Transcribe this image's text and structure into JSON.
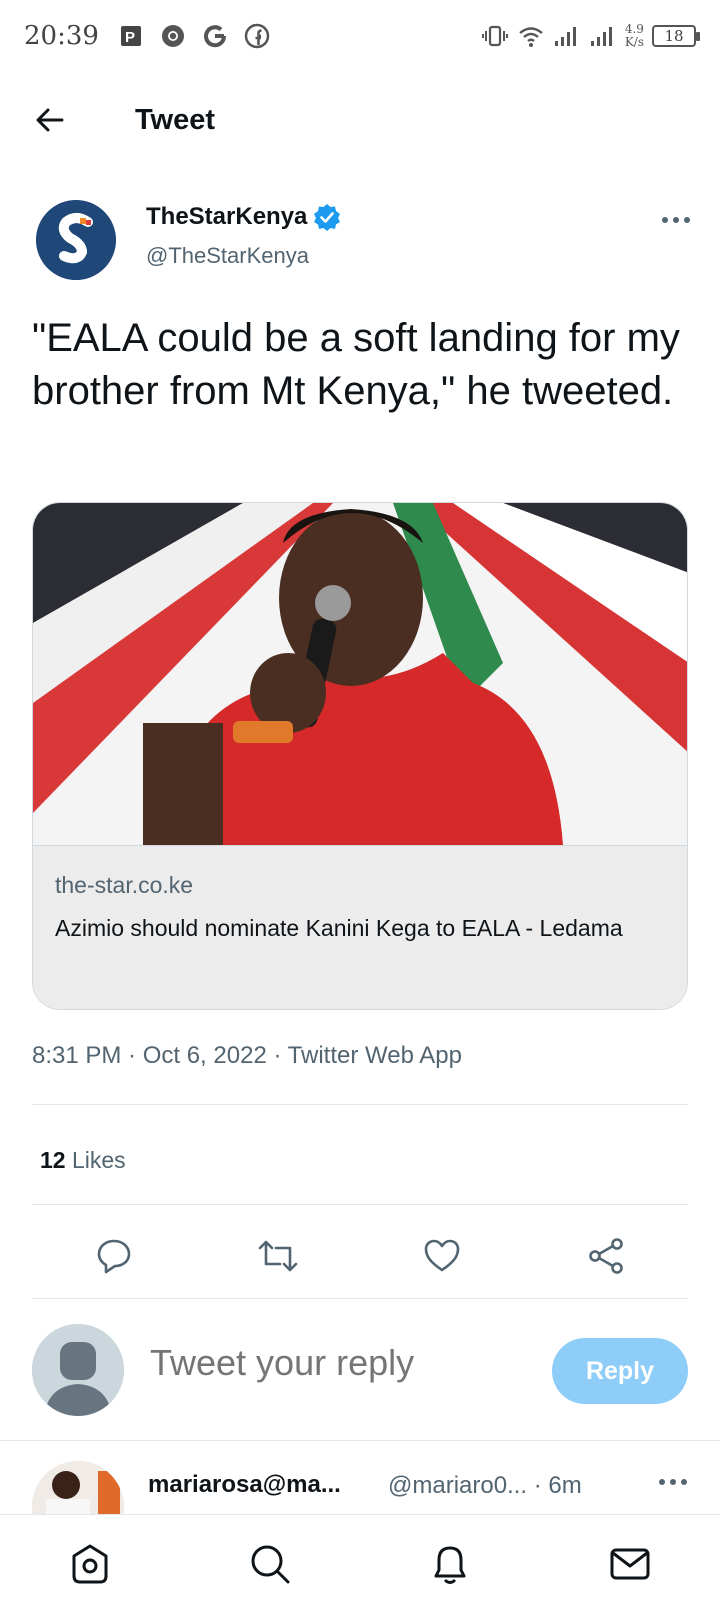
{
  "status_bar": {
    "time": "20:39",
    "net_speed_value": "4.9",
    "net_speed_unit": "K/s",
    "battery": "18",
    "left_icons": [
      "parking-icon",
      "chrome-icon",
      "google-icon",
      "facebook-icon"
    ],
    "right_icons": [
      "vibrate-icon",
      "wifi-icon",
      "signal-icon",
      "signal-icon"
    ]
  },
  "header": {
    "title": "Tweet",
    "back_icon": "arrow-left-icon"
  },
  "tweet": {
    "author_name": "TheStarKenya",
    "verified": true,
    "author_handle": "@TheStarKenya",
    "text": "\"EALA could be a soft landing for my brother from Mt Kenya,\" he tweeted.",
    "card": {
      "domain": "the-star.co.ke",
      "title": "Azimio should nominate Kanini Kega to EALA - Ledama"
    },
    "timestamp": "8:31 PM · Oct 6, 2022 · Twitter Web App",
    "likes_count": "12",
    "likes_label": "Likes"
  },
  "actions": [
    "reply-icon",
    "retweet-icon",
    "like-icon",
    "share-icon"
  ],
  "reply_bar": {
    "placeholder": "Tweet your reply",
    "button_label": "Reply"
  },
  "reply_item": {
    "name": "mariarosa@ma...",
    "handle": "@mariaro0...",
    "time": "· 6m"
  },
  "bottom_nav": [
    "home-icon",
    "search-icon",
    "notifications-icon",
    "messages-icon"
  ],
  "colors": {
    "accent": "#1d9bf0",
    "reply_button_disabled": "#8ecdf8",
    "text": "#0f1419",
    "secondary_text": "#536471"
  }
}
